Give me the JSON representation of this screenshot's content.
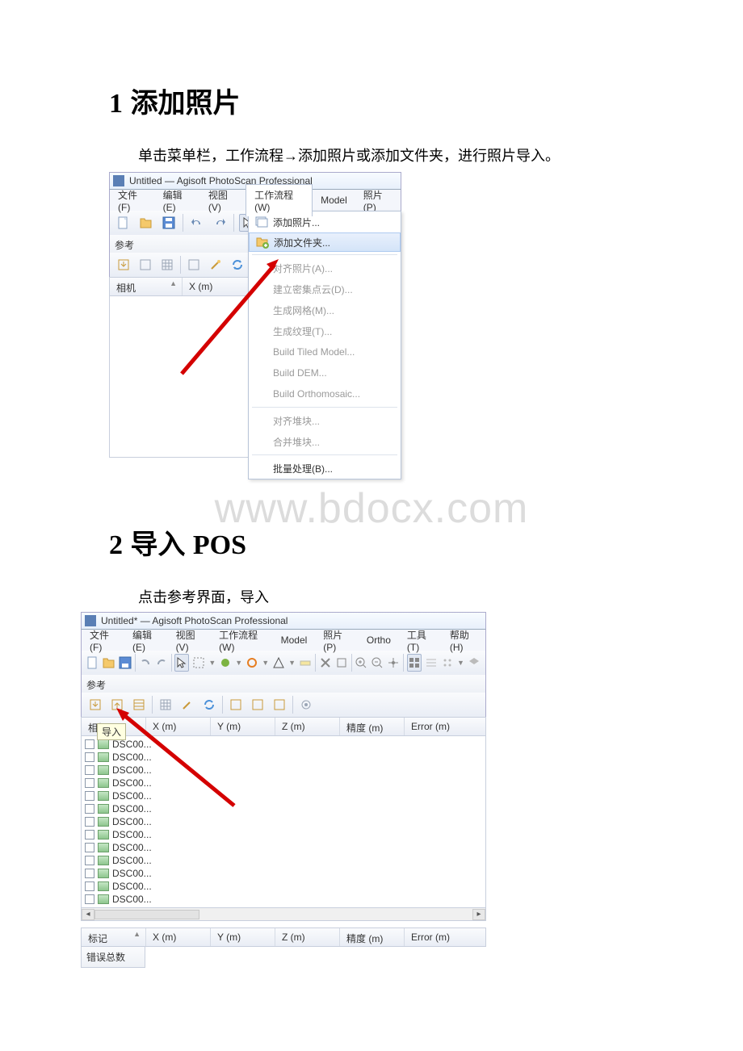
{
  "watermark": "www.bdocx.com",
  "section1": {
    "num": "1",
    "title": "添加照片",
    "para": "单击菜单栏，工作流程→添加照片或添加文件夹，进行照片导入。"
  },
  "section2": {
    "num": "2",
    "title": "导入",
    "suffix": "POS",
    "para": "点击参考界面，导入"
  },
  "shot1": {
    "title": "Untitled — Agisoft PhotoScan Professional",
    "menu": {
      "file": "文件(F)",
      "edit": "编辑(E)",
      "view": "视图(V)",
      "workflow": "工作流程(W)",
      "model": "Model",
      "photo": "照片(P)"
    },
    "panel": "参考",
    "col": {
      "camera": "相机",
      "x": "X (m)"
    },
    "drop": {
      "add_photos": "添加照片...",
      "add_folder": "添加文件夹...",
      "align_photos": "对齐照片(A)...",
      "dense": "建立密集点云(D)...",
      "mesh": "生成网格(M)...",
      "texture": "生成纹理(T)...",
      "tiled": "Build Tiled Model...",
      "dem": "Build DEM...",
      "ortho": "Build Orthomosaic...",
      "align_chunks": "对齐堆块...",
      "merge_chunks": "合并堆块...",
      "batch": "批量处理(B)..."
    }
  },
  "shot2": {
    "title": "Untitled* — Agisoft PhotoScan Professional",
    "menu": {
      "file": "文件(F)",
      "edit": "编辑(E)",
      "view": "视图(V)",
      "workflow": "工作流程(W)",
      "model": "Model",
      "photo": "照片(P)",
      "ortho": "Ortho",
      "tools": "工具(T)",
      "help": "帮助(H)"
    },
    "panel": "参考",
    "tooltip": "导入",
    "col": {
      "camera": "相机",
      "x": "X (m)",
      "y": "Y (m)",
      "z": "Z (m)",
      "acc": "精度 (m)",
      "err": "Error (m)"
    },
    "files": [
      "DSC00...",
      "DSC00...",
      "DSC00...",
      "DSC00...",
      "DSC00...",
      "DSC00...",
      "DSC00...",
      "DSC00...",
      "DSC00...",
      "DSC00...",
      "DSC00...",
      "DSC00...",
      "DSC00..."
    ],
    "col2": {
      "mark": "标记",
      "x": "X (m)",
      "y": "Y (m)",
      "z": "Z (m)",
      "acc": "精度 (m)",
      "err": "Error (m)"
    },
    "err_total": "错误总数"
  }
}
